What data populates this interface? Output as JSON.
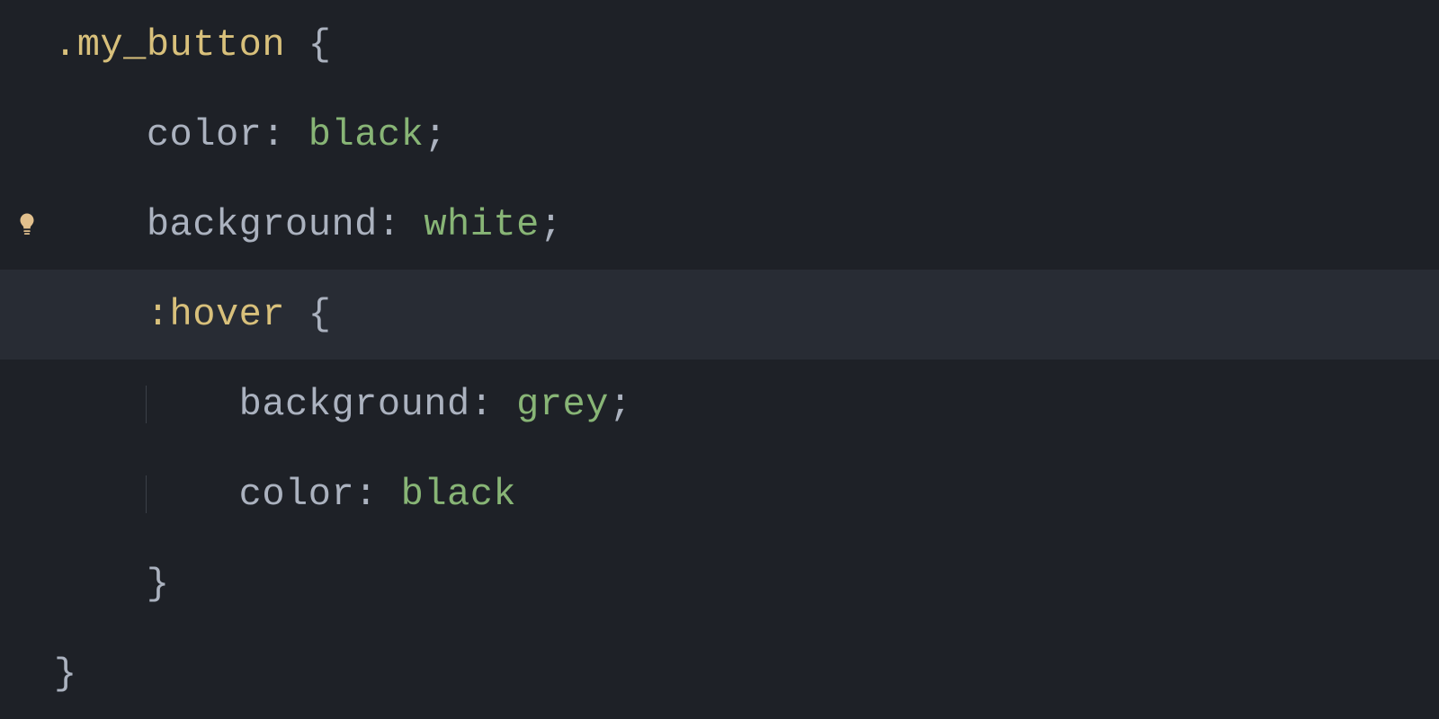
{
  "colors": {
    "bg": "#1e2127",
    "highlight": "#282c34",
    "default": "#abb2bf",
    "selector": "#d8c07b",
    "value": "#88b576",
    "guide": "#3b4048",
    "bulb": "#e2c08d"
  },
  "icons": {
    "lightbulb": "lightbulb-icon"
  },
  "code": {
    "indent": "    ",
    "lines": [
      {
        "gutter": null,
        "indent": 0,
        "highlight": false,
        "tokens": [
          {
            "t": ".my_button",
            "c": "selector"
          },
          {
            "t": " ",
            "c": "punct"
          },
          {
            "t": "{",
            "c": "punct"
          }
        ]
      },
      {
        "gutter": null,
        "indent": 1,
        "highlight": false,
        "tokens": [
          {
            "t": "color",
            "c": "prop"
          },
          {
            "t": ":",
            "c": "punct"
          },
          {
            "t": " ",
            "c": "punct"
          },
          {
            "t": "black",
            "c": "value"
          },
          {
            "t": ";",
            "c": "punct"
          }
        ]
      },
      {
        "gutter": "lightbulb",
        "indent": 1,
        "highlight": false,
        "tokens": [
          {
            "t": "background",
            "c": "prop"
          },
          {
            "t": ":",
            "c": "punct"
          },
          {
            "t": " ",
            "c": "punct"
          },
          {
            "t": "white",
            "c": "value"
          },
          {
            "t": ";",
            "c": "punct"
          }
        ]
      },
      {
        "gutter": null,
        "indent": 1,
        "highlight": true,
        "tokens": [
          {
            "t": ":hover",
            "c": "pseudo"
          },
          {
            "t": " ",
            "c": "punct"
          },
          {
            "t": "{",
            "c": "punct"
          }
        ]
      },
      {
        "gutter": null,
        "indent": 2,
        "highlight": false,
        "guides": [
          1
        ],
        "tokens": [
          {
            "t": "background",
            "c": "prop"
          },
          {
            "t": ":",
            "c": "punct"
          },
          {
            "t": " ",
            "c": "punct"
          },
          {
            "t": "grey",
            "c": "value"
          },
          {
            "t": ";",
            "c": "punct"
          }
        ]
      },
      {
        "gutter": null,
        "indent": 2,
        "highlight": false,
        "guides": [
          1
        ],
        "tokens": [
          {
            "t": "color",
            "c": "prop"
          },
          {
            "t": ":",
            "c": "punct"
          },
          {
            "t": " ",
            "c": "punct"
          },
          {
            "t": "black",
            "c": "value"
          }
        ]
      },
      {
        "gutter": null,
        "indent": 1,
        "highlight": false,
        "tokens": [
          {
            "t": "}",
            "c": "punct"
          }
        ]
      },
      {
        "gutter": null,
        "indent": 0,
        "highlight": false,
        "tokens": [
          {
            "t": "}",
            "c": "punct"
          }
        ]
      }
    ]
  }
}
